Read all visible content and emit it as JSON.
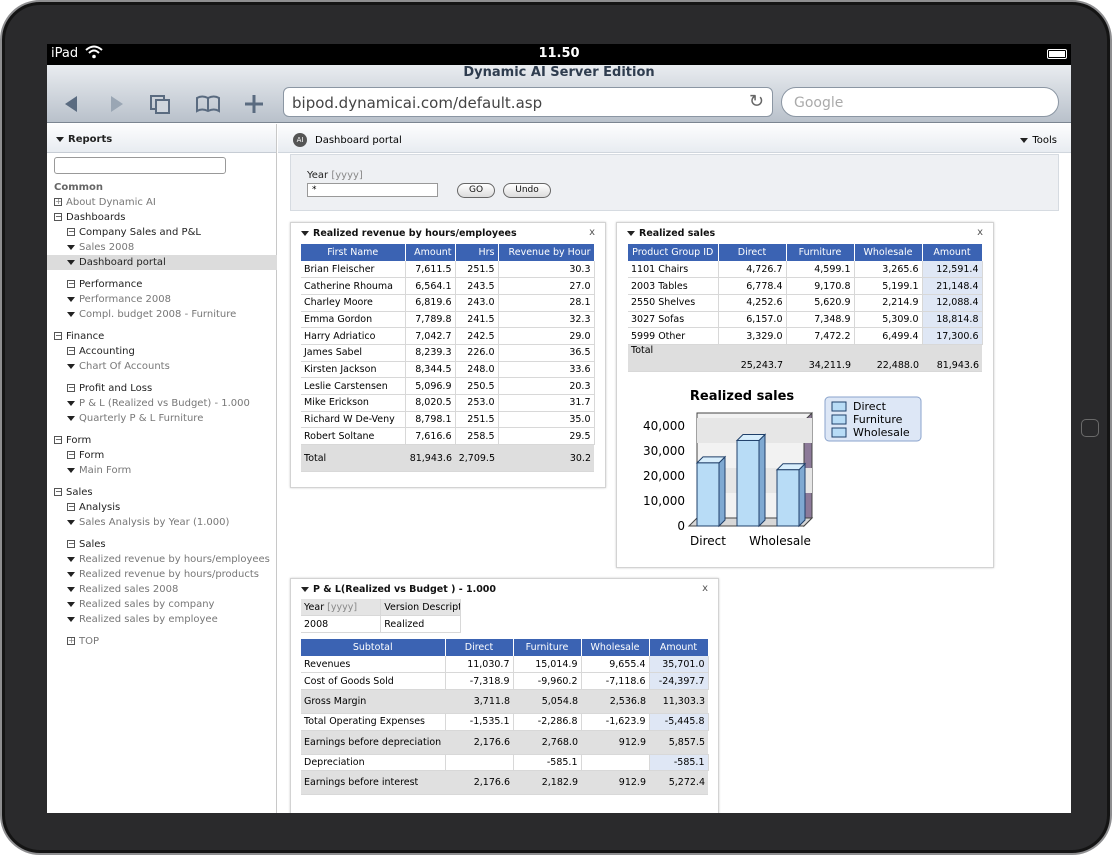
{
  "status": {
    "carrier": "iPad",
    "time": "11.50"
  },
  "browser": {
    "page_title": "Dynamic AI Server Edition",
    "url": "bipod.dynamicai.com/default.asp",
    "search_placeholder": "Google"
  },
  "sidebar": {
    "title": "Reports",
    "items": [
      {
        "label": "Common",
        "type": "heading"
      },
      {
        "label": "About Dynamic AI",
        "type": "plus",
        "level": 0,
        "gray": true
      },
      {
        "label": "Dashboards",
        "type": "minus",
        "level": 0
      },
      {
        "label": "Company Sales and P&L",
        "type": "minus",
        "level": 1
      },
      {
        "label": "Sales 2008",
        "type": "leaf",
        "level": 1,
        "gray": true
      },
      {
        "label": "Dashboard portal",
        "type": "leaf",
        "level": 1,
        "selected": true
      },
      {
        "label": "",
        "type": "gap"
      },
      {
        "label": "Performance",
        "type": "minus",
        "level": 1
      },
      {
        "label": "Performance 2008",
        "type": "leaf",
        "level": 1,
        "gray": true
      },
      {
        "label": "Compl. budget 2008 - Furniture",
        "type": "leaf",
        "level": 1,
        "gray": true
      },
      {
        "label": "",
        "type": "gap"
      },
      {
        "label": "Finance",
        "type": "minus",
        "level": 0
      },
      {
        "label": "Accounting",
        "type": "minus",
        "level": 1
      },
      {
        "label": "Chart Of Accounts",
        "type": "leaf",
        "level": 1,
        "gray": true
      },
      {
        "label": "",
        "type": "gap"
      },
      {
        "label": "Profit and Loss",
        "type": "minus",
        "level": 1
      },
      {
        "label": "P & L (Realized vs Budget) - 1.000",
        "type": "leaf",
        "level": 1,
        "gray": true
      },
      {
        "label": "Quarterly P & L Furniture",
        "type": "leaf",
        "level": 1,
        "gray": true
      },
      {
        "label": "",
        "type": "gap"
      },
      {
        "label": "Form",
        "type": "minus",
        "level": 0
      },
      {
        "label": "Form",
        "type": "minus",
        "level": 1
      },
      {
        "label": "Main Form",
        "type": "leaf",
        "level": 1,
        "gray": true
      },
      {
        "label": "",
        "type": "gap"
      },
      {
        "label": "Sales",
        "type": "minus",
        "level": 0
      },
      {
        "label": "Analysis",
        "type": "minus",
        "level": 1
      },
      {
        "label": "Sales Analysis by Year (1.000)",
        "type": "leaf",
        "level": 1,
        "gray": true
      },
      {
        "label": "",
        "type": "gap"
      },
      {
        "label": "Sales",
        "type": "minus",
        "level": 1
      },
      {
        "label": "Realized revenue by hours/employees",
        "type": "leaf",
        "level": 1,
        "gray": true
      },
      {
        "label": "Realized revenue by hours/products",
        "type": "leaf",
        "level": 1,
        "gray": true
      },
      {
        "label": "Realized sales 2008",
        "type": "leaf",
        "level": 1,
        "gray": true
      },
      {
        "label": "Realized sales by company",
        "type": "leaf",
        "level": 1,
        "gray": true
      },
      {
        "label": "Realized sales by employee",
        "type": "leaf",
        "level": 1,
        "gray": true
      },
      {
        "label": "",
        "type": "gap"
      },
      {
        "label": "TOP",
        "type": "plus",
        "level": 1,
        "gray": true
      }
    ]
  },
  "main": {
    "portal_title": "Dashboard portal",
    "tools_label": "Tools",
    "filter": {
      "year_label": "Year",
      "year_hint": "[yyyy]",
      "year_value": "*",
      "go": "GO",
      "undo": "Undo"
    }
  },
  "revenue_panel": {
    "title": "Realized revenue by hours/employees",
    "close": "x",
    "headers": [
      "First Name",
      "Amount",
      "Hrs",
      "Revenue by Hour"
    ],
    "rows": [
      [
        "Brian Fleischer",
        "7,611.5",
        "251.5",
        "30.3"
      ],
      [
        "Catherine Rhouma",
        "6,564.1",
        "243.5",
        "27.0"
      ],
      [
        "Charley Moore",
        "6,819.6",
        "243.0",
        "28.1"
      ],
      [
        "Emma Gordon",
        "7,789.8",
        "241.5",
        "32.3"
      ],
      [
        "Harry Adriatico",
        "7,042.7",
        "242.5",
        "29.0"
      ],
      [
        "James Sabel",
        "8,239.3",
        "226.0",
        "36.5"
      ],
      [
        "Kirsten Jackson",
        "8,344.5",
        "248.0",
        "33.6"
      ],
      [
        "Leslie Carstensen",
        "5,096.9",
        "250.5",
        "20.3"
      ],
      [
        "Mike Erickson",
        "8,020.5",
        "253.0",
        "31.7"
      ],
      [
        "Richard W De-Veny",
        "8,798.1",
        "251.5",
        "35.0"
      ],
      [
        "Robert Soltane",
        "7,616.6",
        "258.5",
        "29.5"
      ]
    ],
    "total": [
      "Total",
      "81,943.6",
      "2,709.5",
      "30.2"
    ]
  },
  "sales_panel": {
    "title": "Realized sales",
    "close": "x",
    "headers": [
      "Product Group ID",
      "Direct",
      "Furniture",
      "Wholesale",
      "Amount"
    ],
    "rows": [
      [
        "1101 Chairs",
        "4,726.7",
        "4,599.1",
        "3,265.6",
        "12,591.4"
      ],
      [
        "2003 Tables",
        "6,778.4",
        "9,170.8",
        "5,199.1",
        "21,148.4"
      ],
      [
        "2550 Shelves",
        "4,252.6",
        "5,620.9",
        "2,214.9",
        "12,088.4"
      ],
      [
        "3027 Sofas",
        "6,157.0",
        "7,348.9",
        "5,309.0",
        "18,814.8"
      ],
      [
        "5999 Other",
        "3,329.0",
        "7,472.2",
        "6,499.4",
        "17,300.6"
      ]
    ],
    "total": [
      "Total",
      "25,243.7",
      "34,211.9",
      "22,488.0",
      "81,943.6"
    ]
  },
  "chart_data": {
    "type": "bar",
    "title": "Realized sales",
    "categories": [
      "Direct",
      "Furniture",
      "Wholesale"
    ],
    "x_tick_labels": [
      "Direct",
      "",
      "Wholesale"
    ],
    "values": [
      25243.7,
      34211.9,
      22488.0
    ],
    "y_ticks": [
      "0",
      "10,000",
      "20,000",
      "30,000",
      "40,000"
    ],
    "ylim": [
      0,
      40000
    ],
    "legend": [
      "Direct",
      "Furniture",
      "Wholesale"
    ],
    "legend_position": "top-right",
    "colors": {
      "bar": "#b8dcf6",
      "bar_edge": "#20406a"
    }
  },
  "pl_panel": {
    "title": "P & L(Realized vs Budget ) - 1.000",
    "close": "x",
    "param_headers": [
      "Year",
      "[yyyy]",
      "Version Description"
    ],
    "param_values": [
      "2008",
      "Realized"
    ],
    "headers": [
      "Subtotal",
      "Direct",
      "Furniture",
      "Wholesale",
      "Amount"
    ],
    "rows": [
      {
        "cells": [
          "Revenues",
          "11,030.7",
          "15,014.9",
          "9,655.4",
          "35,701.0"
        ],
        "shade": false
      },
      {
        "cells": [
          "Cost of Goods Sold",
          "-7,318.9",
          "-9,960.2",
          "-7,118.6",
          "-24,397.7"
        ],
        "shade": false
      },
      {
        "cells": [
          "Gross Margin",
          "3,711.8",
          "5,054.8",
          "2,536.8",
          "11,303.3"
        ],
        "shade": true
      },
      {
        "cells": [
          "Total Operating Expenses",
          "-1,535.1",
          "-2,286.8",
          "-1,623.9",
          "-5,445.8"
        ],
        "shade": false
      },
      {
        "cells": [
          "Earnings before depreciation",
          "2,176.6",
          "2,768.0",
          "912.9",
          "5,857.5"
        ],
        "shade": true
      },
      {
        "cells": [
          "Depreciation",
          "",
          "-585.1",
          "",
          "-585.1"
        ],
        "shade": false
      },
      {
        "cells": [
          "Earnings before interest",
          "2,176.6",
          "2,182.9",
          "912.9",
          "5,272.4"
        ],
        "shade": true
      }
    ]
  }
}
